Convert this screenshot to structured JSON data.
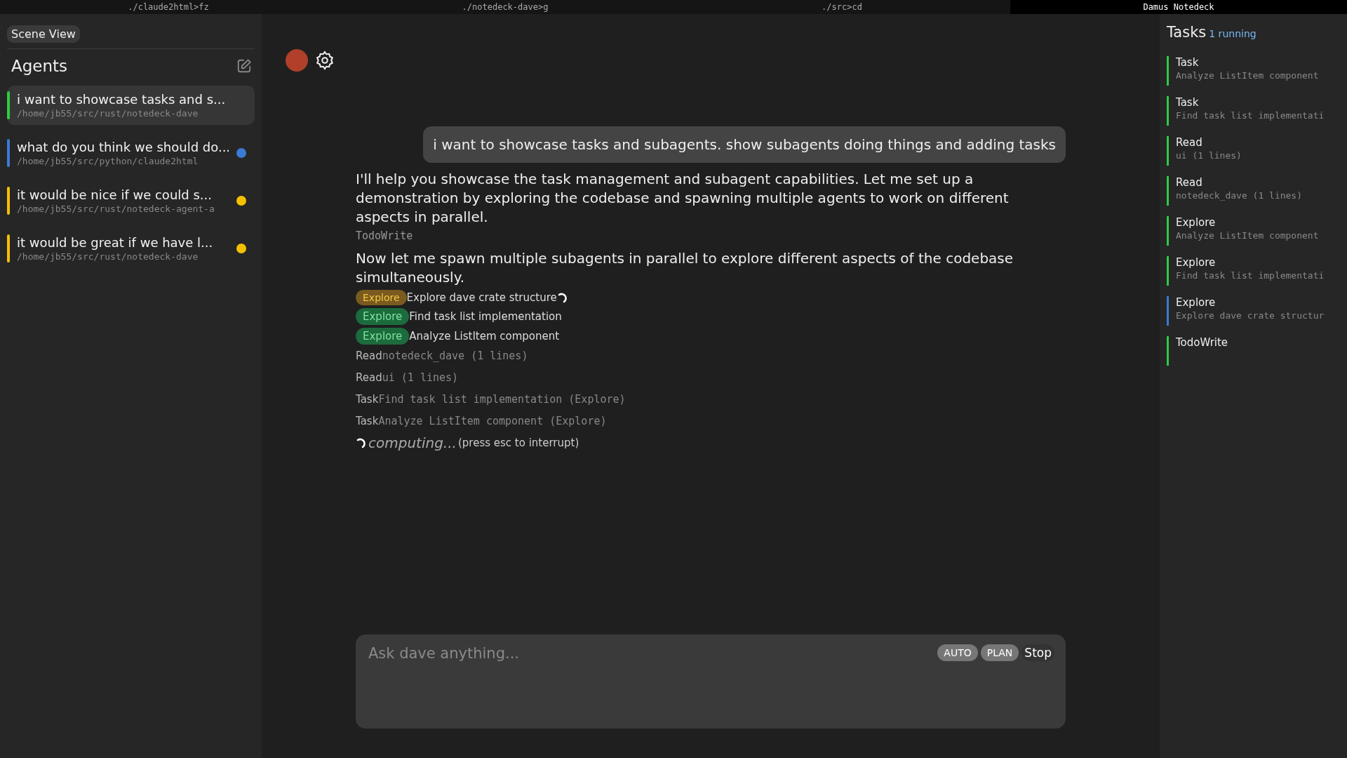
{
  "terminal_tabs": [
    {
      "label": "./claude2html>fz",
      "selected": false
    },
    {
      "label": "./notedeck-dave>g",
      "selected": false
    },
    {
      "label": "./src>cd",
      "selected": false
    },
    {
      "label": "Damus Notedeck",
      "selected": true
    }
  ],
  "sidebar": {
    "scene_view_button": "Scene View",
    "title": "Agents",
    "items": [
      {
        "title": "i want to showcase tasks and s...",
        "path": "/home/jb55/src/rust/notedeck-dave",
        "selected": true,
        "color": "#2ecc40",
        "unread": false
      },
      {
        "title": "what do you think we should do...",
        "path": "/home/jb55/src/python/claude2html",
        "selected": false,
        "color": "#3a7bd5",
        "unread": true
      },
      {
        "title": "it would be nice if we could s...",
        "path": "/home/jb55/src/rust/notedeck-agent-a",
        "selected": false,
        "color": "#f5c000",
        "unread": true
      },
      {
        "title": "it would be great if we have l...",
        "path": "/home/jb55/src/rust/notedeck-dave",
        "selected": false,
        "color": "#f5c000",
        "unread": true
      }
    ]
  },
  "chat": {
    "messages": [
      {
        "kind": "user",
        "text": "i want to showcase tasks and subagents. show subagents doing things and adding tasks"
      },
      {
        "kind": "assistant",
        "text": "I'll help you showcase the task management and subagent capabilities. Let me set up a demonstration by exploring the codebase and spawning multiple agents to work on different aspects in parallel."
      },
      {
        "kind": "tool",
        "name": "TodoWrite"
      },
      {
        "kind": "assistant",
        "text": "Now let me spawn multiple subagents in parallel to explore different aspects of the codebase simultaneously."
      },
      {
        "kind": "subagent",
        "badge": "Explore",
        "text": "Explore dave crate structure",
        "running": true
      },
      {
        "kind": "subagent",
        "badge": "Explore",
        "text": "Find task list implementation",
        "running": false
      },
      {
        "kind": "subagent",
        "badge": "Explore",
        "text": "Analyze ListItem component",
        "running": false
      },
      {
        "kind": "tool_result",
        "name": "Read",
        "detail": "notedeck_dave (1 lines)"
      },
      {
        "kind": "tool_result",
        "name": "Read",
        "detail": "ui (1 lines)"
      },
      {
        "kind": "tool_result",
        "name": "Task",
        "detail": "Find task list implementation (Explore)"
      },
      {
        "kind": "tool_result",
        "name": "Task",
        "detail": "Analyze ListItem component (Explore)"
      }
    ],
    "status": {
      "label": "computing...",
      "hint": "(press esc to interrupt)"
    },
    "input": {
      "placeholder": "Ask dave anything...",
      "buttons": [
        "AUTO",
        "PLAN",
        "Stop"
      ]
    }
  },
  "tasks": {
    "title": "Tasks",
    "running": "1 running",
    "items": [
      {
        "name": "Task",
        "detail": "Analyze ListItem component",
        "color": "#2ecc40"
      },
      {
        "name": "Task",
        "detail": "Find task list implementati",
        "color": "#2ecc40"
      },
      {
        "name": "Read",
        "detail": "ui (1 lines)",
        "color": "#2ecc40"
      },
      {
        "name": "Read",
        "detail": "notedeck_dave (1 lines)",
        "color": "#2ecc40"
      },
      {
        "name": "Explore",
        "detail": "Analyze ListItem component",
        "color": "#2ecc40"
      },
      {
        "name": "Explore",
        "detail": "Find task list implementati",
        "color": "#2ecc40"
      },
      {
        "name": "Explore",
        "detail": "Explore dave crate structur",
        "color": "#3a7bd5"
      },
      {
        "name": "TodoWrite",
        "color": "#2ecc40"
      }
    ]
  }
}
